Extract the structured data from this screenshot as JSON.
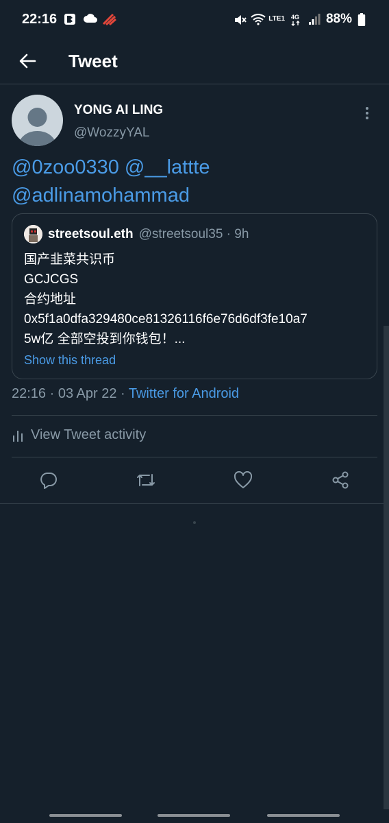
{
  "status_bar": {
    "time": "22:16",
    "network_label": "LTE1",
    "battery": "88%"
  },
  "header": {
    "title": "Tweet"
  },
  "tweet": {
    "author_name": "YONG AI LING",
    "author_handle": "@WozzyYAL",
    "mention_1": "@0zoo0330",
    "mention_2": "@__lattte",
    "mention_3": "@adlinamohammad",
    "timestamp": "22:16 · 03 Apr 22 · ",
    "source": "Twitter for Android"
  },
  "quoted_tweet": {
    "name": "streetsoul.eth",
    "handle": "@streetsoul35 · 9h",
    "lines": [
      "国产韭菜共识币",
      "GCJCGS",
      "合约地址",
      "0x5f1a0dfa329480ce81326116f6e76d6df3fe10a7",
      "5w亿  全部空投到你钱包！..."
    ],
    "show_thread": "Show this thread"
  },
  "activity": {
    "label": "View Tweet activity"
  },
  "icons": {
    "back": "arrow-left-icon",
    "more": "more-vertical-icon",
    "reply": "reply-icon",
    "retweet": "retweet-icon",
    "like": "heart-icon",
    "share": "share-icon"
  },
  "colors": {
    "background": "#15202b",
    "accent": "#4a9be6",
    "secondary_text": "#8899a6",
    "border": "#38444d"
  }
}
